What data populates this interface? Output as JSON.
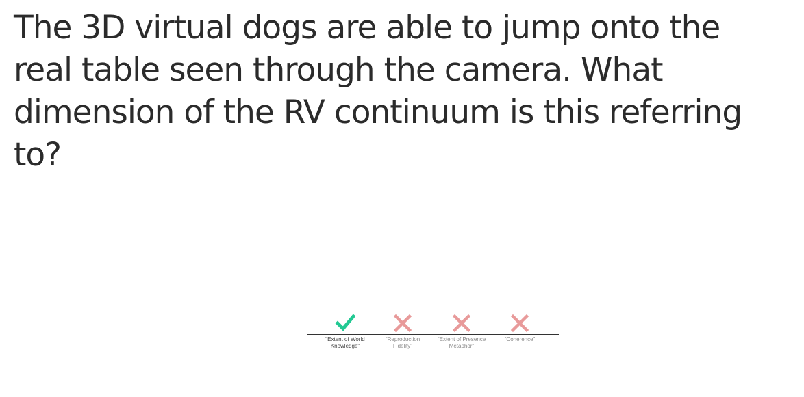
{
  "question": {
    "text": "The 3D virtual dogs are able to jump onto the real table seen through the camera. What dimension of the RV continuum is this referring to?"
  },
  "results": {
    "options": [
      {
        "label": "\"Extent of World Knowledge\"",
        "status": "correct",
        "icon": "check-icon"
      },
      {
        "label": "\"Reproduction Fidelity\"",
        "status": "incorrect",
        "icon": "cross-icon"
      },
      {
        "label": "\"Extent of Presence Metaphor\"",
        "status": "incorrect",
        "icon": "cross-icon"
      },
      {
        "label": "\"Coherence\"",
        "status": "incorrect",
        "icon": "cross-icon"
      }
    ]
  },
  "colors": {
    "correct": "#22c993",
    "incorrect": "#e89a9a",
    "text": "#2b2b2b"
  }
}
